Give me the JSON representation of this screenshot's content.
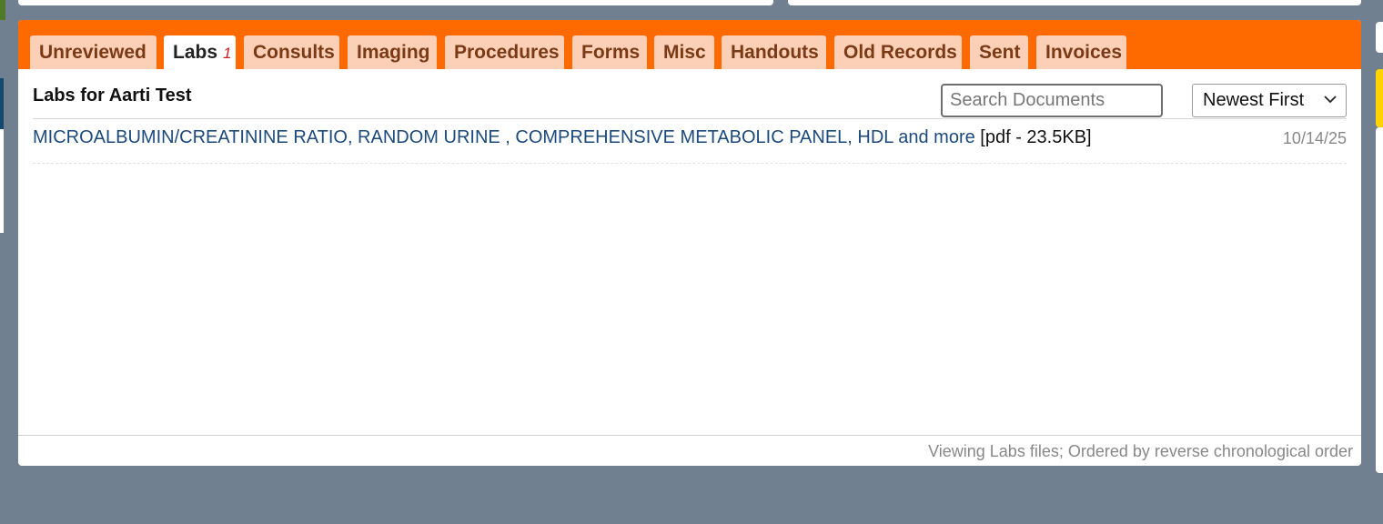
{
  "tabs": [
    {
      "label": "Unreviewed",
      "active": false
    },
    {
      "label": "Labs",
      "active": true,
      "badge": "1"
    },
    {
      "label": "Consults",
      "active": false
    },
    {
      "label": "Imaging",
      "active": false
    },
    {
      "label": "Procedures",
      "active": false
    },
    {
      "label": "Forms",
      "active": false
    },
    {
      "label": "Misc",
      "active": false
    },
    {
      "label": "Handouts",
      "active": false
    },
    {
      "label": "Old Records",
      "active": false
    },
    {
      "label": "Sent",
      "active": false
    },
    {
      "label": "Invoices",
      "active": false
    }
  ],
  "content": {
    "title": "Labs for Aarti Test",
    "search_placeholder": "Search Documents",
    "sort_value": "Newest First"
  },
  "documents": [
    {
      "name": "MICROALBUMIN/CREATININE RATIO, RANDOM URINE , COMPREHENSIVE METABOLIC PANEL, HDL and more",
      "meta": "[pdf - 23.5KB]",
      "date": "10/14/25"
    }
  ],
  "footer": {
    "status": "Viewing Labs files; Ordered by reverse chronological order"
  },
  "colors": {
    "tabbar": "#ff6a00",
    "tab": "#fcd0b7",
    "tab_text": "#7a3a16",
    "link": "#1c4a7c",
    "badge": "#cc1f1f",
    "background": "#708090"
  },
  "icons": {
    "sort_chevron": "chevron-down-icon"
  }
}
